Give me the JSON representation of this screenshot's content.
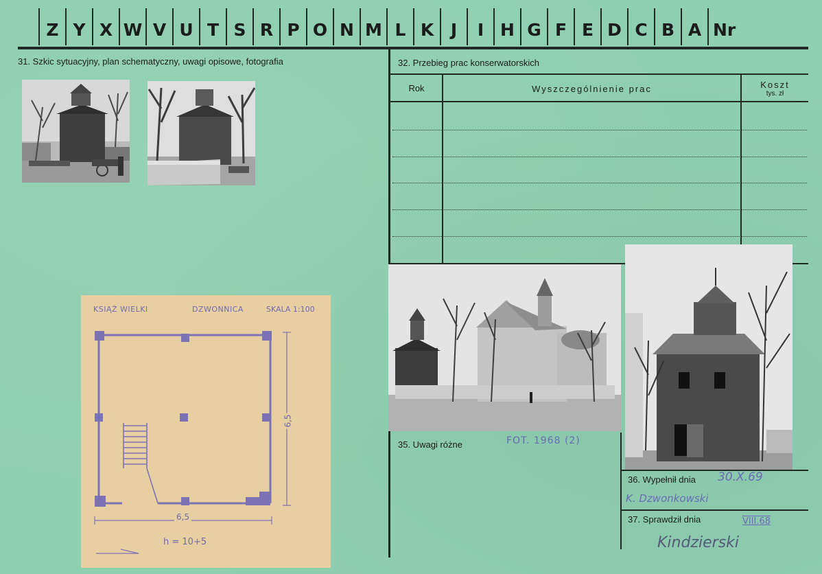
{
  "index_letters": [
    "Z",
    "Y",
    "X",
    "W",
    "V",
    "U",
    "T",
    "S",
    "R",
    "P",
    "O",
    "N",
    "M",
    "L",
    "K",
    "J",
    "I",
    "H",
    "G",
    "F",
    "E",
    "D",
    "C",
    "B",
    "A"
  ],
  "index_nr_label": "Nr",
  "section31": {
    "label": "31. Szkic sytuacyjny, plan schematyczny, uwagi opisowe, fotografia"
  },
  "section32": {
    "label": "32. Przebieg prac konserwatorskich",
    "col_rok": "Rok",
    "col_works": "Wyszczególnienie prac",
    "col_cost": "Koszt",
    "col_cost_unit": "tys. zł"
  },
  "section35": {
    "label": "35. Uwagi różne",
    "note": "FOT. 1968 (2)"
  },
  "section36": {
    "label": "36. Wypełnił dnia",
    "date": "30.X.69",
    "signature": "K. Dzwonkowski"
  },
  "section37": {
    "label": "37. Sprawdził dnia",
    "date": "VIII.68",
    "signature": "Kindzierski"
  },
  "sketch": {
    "place": "KSIĄŻ WIELKI",
    "title": "DZWONNICA",
    "scale": "SKALA 1:100",
    "width_dim": "6,5",
    "depth_dim": "6,5",
    "height_note": "h = 10+5"
  },
  "colors": {
    "card": "#8fcfb1",
    "line": "#1f2a24",
    "ink": "#6b6bb5",
    "paper": "#e8cfa2"
  }
}
